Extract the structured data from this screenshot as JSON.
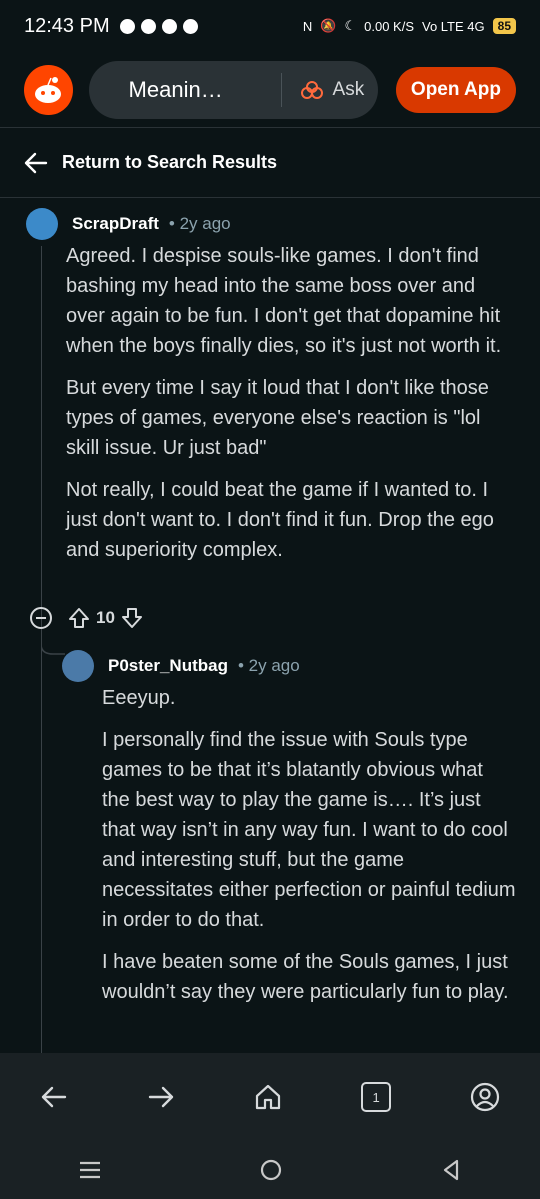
{
  "status_bar": {
    "time": "12:43 PM",
    "net_speed": "0.00 K/S",
    "network": "Vo LTE 4G",
    "battery": "85"
  },
  "header": {
    "search_text": "Meanin…",
    "ask_label": "Ask",
    "open_app_label": "Open App"
  },
  "back": {
    "label": "Return to Search Results"
  },
  "comments": [
    {
      "author": "ScrapDraft",
      "age": "• 2y ago",
      "paragraphs": [
        "Agreed. I despise souls-like games. I don't find bashing my head into the same boss over and over again to be fun. I don't get that dopamine hit when the boys finally dies, so it's just not worth it.",
        "But every time I say it loud that I don't like those types of games, everyone else's reaction is \"lol skill issue. Ur just bad\"",
        "Not really, I could beat the game if I wanted to. I just don't want to. I don't find it fun. Drop the ego and superiority complex."
      ],
      "score": "10"
    },
    {
      "author": "P0ster_Nutbag",
      "age": "• 2y ago",
      "paragraphs": [
        "Eeeyup.",
        "I personally find the issue with Souls type games to be that it’s blatantly obvious what the best way to play the game is…. It’s just that way isn’t in any way fun. I want to do cool and interesting stuff, but the game necessitates either perfection or painful tedium in order to do that.",
        "I have beaten some of the Souls games, I just wouldn’t say they were particularly fun to play."
      ]
    }
  ],
  "bottom_nav": {
    "tab_count": "1"
  },
  "icons": [
    "back-arrow-icon",
    "forward-arrow-icon",
    "home-icon",
    "tabs-icon",
    "profile-icon",
    "menu-icon",
    "circle-home-icon",
    "triangle-back-icon"
  ],
  "colors": {
    "accent": "#ff4500",
    "button": "#d93900",
    "background": "#0b1416"
  }
}
